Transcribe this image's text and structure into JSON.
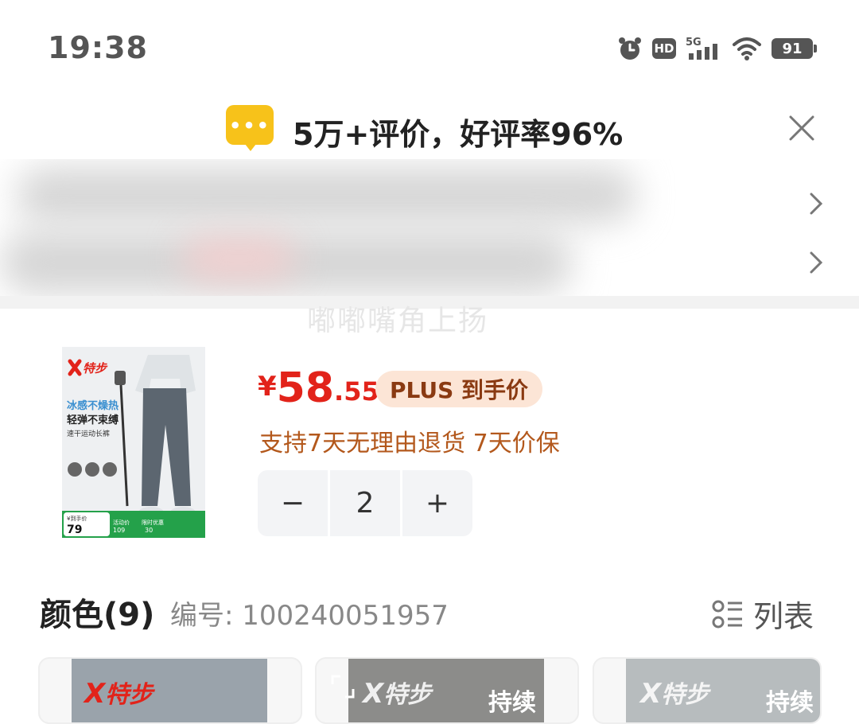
{
  "status_bar": {
    "time": "19:38",
    "network": "5G",
    "hd": "HD",
    "battery": "91",
    "icons": [
      "alarm-icon",
      "hd-icon",
      "signal-5g-icon",
      "wifi-icon",
      "battery-icon"
    ]
  },
  "review_banner": {
    "text": "5万+评价，好评率96%",
    "icon": "message-bubble-icon"
  },
  "watermark": "嘟嘟嘴角上扬",
  "product": {
    "image": {
      "brand": "特步",
      "line1": "冰感不燥热",
      "line2": "轻弹不束缚",
      "line3": "速干运动长裤",
      "promo_label": "¥到手价",
      "promo_price": "79",
      "promo_sub1": "活动价",
      "promo_val1": "109",
      "promo_sub2": "限时优惠",
      "promo_val2": "30"
    },
    "price_symbol": "¥",
    "price_integer": "58",
    "price_decimal": ".55",
    "price_badge": "PLUS 到手价",
    "service_text": "支持7天无理由退货  7天价保",
    "quantity": "2",
    "minus_label": "−",
    "plus_label": "+"
  },
  "color_section": {
    "title": "颜色(9)",
    "sku_label": "编号: 100240051957",
    "list_label": "列表"
  },
  "swatches": [
    {
      "logo": "特步",
      "tag": ""
    },
    {
      "logo": "特步",
      "tag": "持续"
    },
    {
      "logo": "特步",
      "tag": "持续"
    }
  ],
  "colors": {
    "price_red": "#e2231a",
    "badge_bg": "#fce5d6",
    "service_orange": "#b3581c",
    "bubble_yellow": "#f7c21a"
  }
}
